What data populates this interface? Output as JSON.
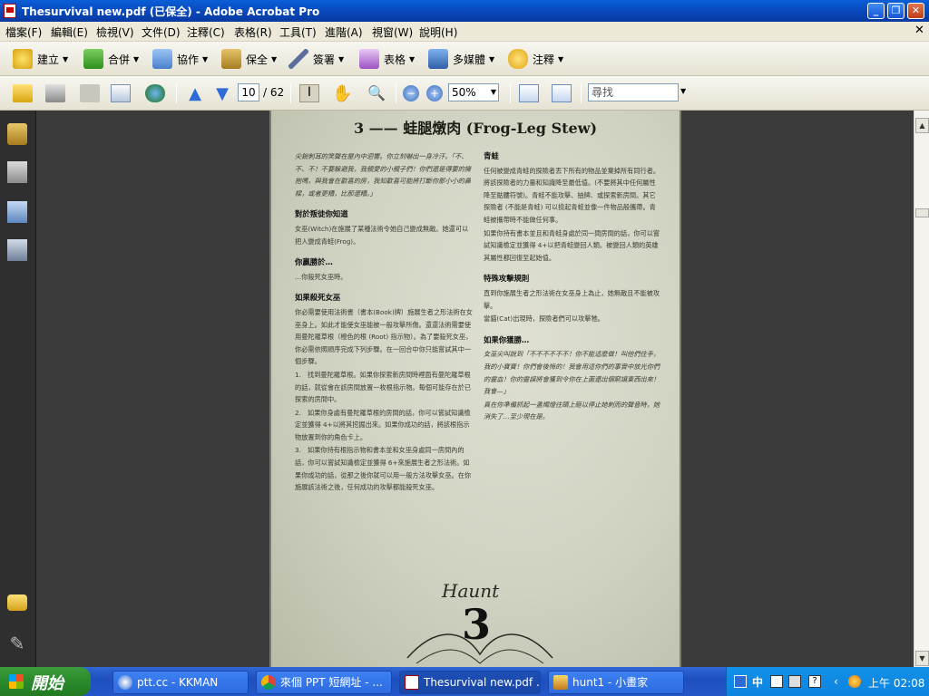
{
  "window": {
    "title": "Thesurvival new.pdf (已保全) - Adobe Acrobat Pro"
  },
  "menu": [
    "檔案(F)",
    "編輯(E)",
    "檢視(V)",
    "文件(D)",
    "注釋(C)",
    "表格(R)",
    "工具(T)",
    "進階(A)",
    "視窗(W)",
    "說明(H)"
  ],
  "task_toolbar": {
    "create": "建立",
    "combine": "合併",
    "collaborate": "協作",
    "secure": "保全",
    "sign": "簽署",
    "forms": "表格",
    "multimedia": "多媒體",
    "comment": "注釋"
  },
  "nav": {
    "current_page": "10",
    "total_pages": "/ 62",
    "zoom": "50%",
    "find_placeholder": "尋找"
  },
  "document": {
    "title": "3 —— 蛙腿燉肉 (Frog-Leg Stew)",
    "left": {
      "intro": "尖銳刺耳的笑聲在屋內中迴響。你立刻嚇出一身冷汗。「不、不、不！不要躲避我，我親愛的小親子們！你們還是得要的擁抱嗎，與我會在歡喜的房，我知歡喜可能將打斷你那小小的鼻樑，或者更糟，比那還糟。」",
      "h1": "對於叛徒你知道",
      "p1": "女巫(Witch)在施展了某種法術令她自己變成無敵。她還可以把人變成青蛙(Frog)。",
      "h2": "你贏勝於…",
      "p2": "…你殺死女巫時。",
      "h3": "如果殺死女巫",
      "p3": "你必需要使用法術書（書本(Book)牌）施展生者之形法術在女巫身上。如此才能使女巫能被一般攻擊所傷。還還法術需要使用曼陀羅草根（橙色的根 (Root) 指示物）。為了要殺死女巫，你必需依照順序完成下列步驟。在一回合中你只能嘗試其中一個步驟。",
      "p4": "1.　找到曼陀羅草根。如果你探索新房間時裡面有曼陀羅草根的話，就從會在該房間放置一枚根指示物。每個可能存在於已探索的房間中。",
      "p5": "2.　如果你身處有曼陀羅草根的房間的話，你可以嘗試知識檢定並獲得 4+以將其挖掘出來。如果你成功的話，將該根指示物放置到你的角色卡上。",
      "p6": "3.　如果你持有根指示物和書本並和女巫身處同一房間內的話，你可以嘗試知識檢定並獲得 6+來施展生者之形法術。如果你成功的話，從那之後你就可以用一般方法攻擊女巫。在你施展該法術之後，任何成功的攻擊都能殺死女巫。"
    },
    "right": {
      "h1": "青蛙",
      "p1": "任何被變成青蛙的探險者丟下所有的物品並棄掉所有同行者。將該探險者的力量和知識降至最低值。(不要將其中任何屬性降至骷髏符號)。青蛙不能攻擊、抽牌、或探索新房間。其它探險者 (不能是青蛙) 可以撿起青蛙並像一件物品般攜帶。青蛙被攜帶時不能做任何事。",
      "p2": "如果你持有書本並且和青蛙身處於同一間房間的話，你可以嘗試知識檢定並獲得 4+以把青蛙變回人類。被變回人類的英雄其屬性都回復至起始值。",
      "h2": "特殊攻擊規則",
      "p3": "直到你施展生者之形法術在女巫身上為止，她無敵且不能被攻擊。",
      "p4": "當貓(Cat)出現時，探險者們可以攻擊牠。",
      "h3": "如果你獲勝…",
      "p5": "女巫尖叫說到「不不不不不不！你不能這麼做！叫他們住手，我的小寶寶！你們會後悔的！我會用這你們的事實中放光你們的靈血！你的靈誤將會獲到令你在上面還出個窮讓東西出來！我會—」",
      "p6": "真在你準備抓起一盞燭燈往頭上砸以停止她刺而的聲音時，她消失了…至少現在是。"
    },
    "footer_word": "Haunt",
    "footer_num": "3"
  },
  "taskbar": {
    "start": "開始",
    "tasks": [
      "ptt.cc - KKMAN",
      "來個 PPT 短網址 - ...",
      "Thesurvival new.pdf ...",
      "hunt1 - 小畫家"
    ],
    "ime": "中",
    "clock": "上午 02:08"
  }
}
